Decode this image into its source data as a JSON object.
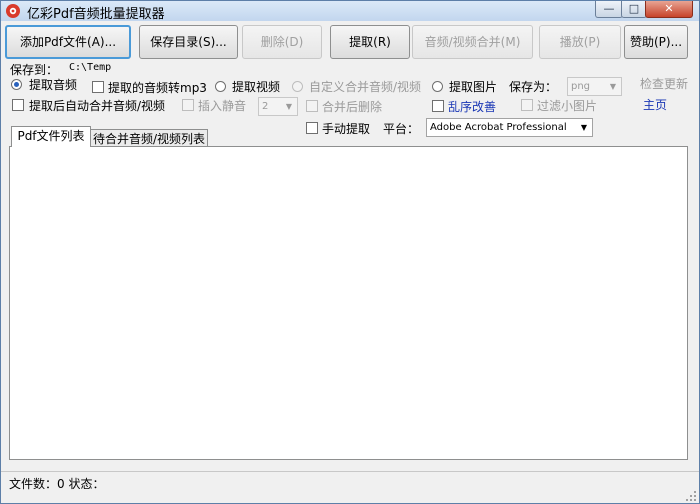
{
  "window": {
    "title": "亿彩Pdf音频批量提取器"
  },
  "toolbar": {
    "add_pdf": "添加Pdf文件(A)...",
    "save_dir": "保存目录(S)...",
    "delete": "删除(D)",
    "extract": "提取(R)",
    "merge": "音频/视频合并(M)",
    "play": "播放(P)",
    "sponsor": "赞助(P)..."
  },
  "options": {
    "save_to_label": "保存到：",
    "save_to_path": "C:\\Temp",
    "extract_audio": "提取音频",
    "audio_to_mp3": "提取的音频转mp3",
    "extract_video": "提取视频",
    "custom_merge": "自定义合并音频/视频",
    "extract_image": "提取图片",
    "save_as_label": "保存为：",
    "save_as_value": "png",
    "check_update": "检查更新",
    "auto_merge": "提取后自动合并音频/视频",
    "insert_silence": "插入静音",
    "silence_value": "2",
    "delete_after_merge": "合并后删除",
    "shuffle": "乱序改善",
    "filter_small": "过滤小图片",
    "homepage": "主页",
    "manual_extract": "手动提取",
    "platform_label": "平台：",
    "platform_value": "Adobe Acrobat Professional"
  },
  "tabs": {
    "pdf_list": "Pdf文件列表",
    "merge_list": "待合并音频/视频列表"
  },
  "status": {
    "text": "文件数：0  状态："
  },
  "icons": {
    "app": "app-logo-icon",
    "minimize": "minimize-icon",
    "maximize": "maximize-icon",
    "close": "close-icon",
    "dropdown": "chevron-down-icon",
    "grip": "resize-grip-icon"
  },
  "colors": {
    "accent": "#4a9ad8",
    "link": "#1a37b5",
    "close": "#c7432a"
  }
}
